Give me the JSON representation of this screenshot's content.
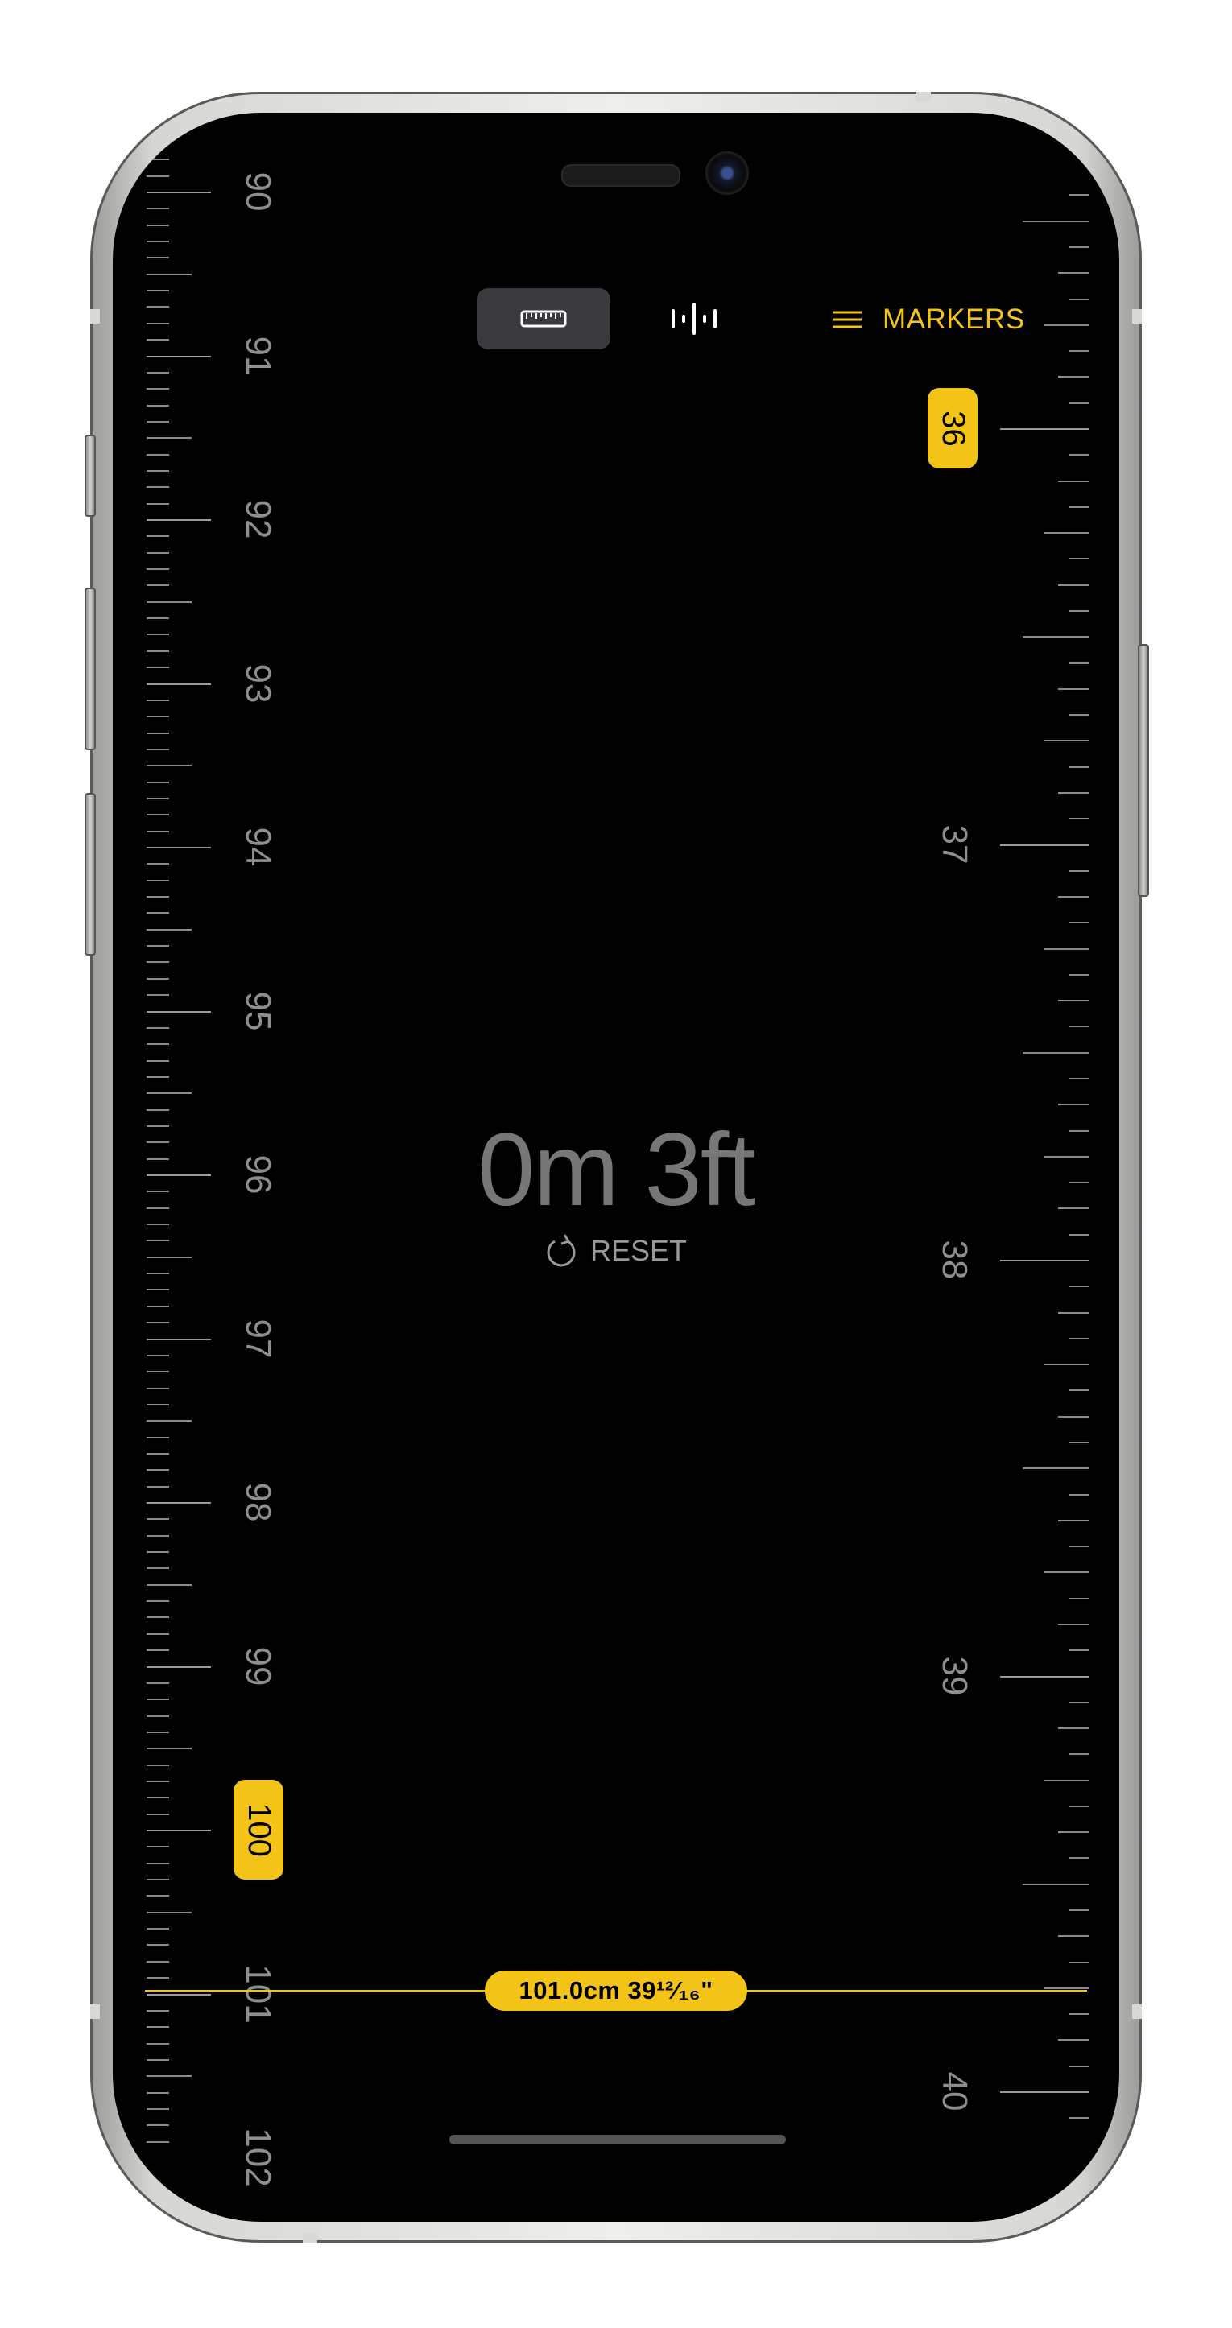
{
  "toolbar": {
    "modes": [
      {
        "name": "ruler-mode",
        "icon": "ruler-icon",
        "selected": true
      },
      {
        "name": "level-mode",
        "icon": "waveform-icon",
        "selected": false
      }
    ],
    "markers_label": "MARKERS"
  },
  "left_ruler": {
    "unit": "cm",
    "labels": [
      "90",
      "91",
      "92",
      "93",
      "94",
      "95",
      "96",
      "97",
      "98",
      "99",
      "100",
      "101",
      "102"
    ],
    "highlighted": "100"
  },
  "right_ruler": {
    "unit": "in",
    "labels": [
      "36",
      "37",
      "38",
      "39",
      "40"
    ],
    "highlighted": "36"
  },
  "readout": {
    "value": "0m  3ft",
    "reset_label": "RESET"
  },
  "measurement": {
    "label": "101.0cm  39¹²⁄₁₆\""
  },
  "colors": {
    "accent": "#f3c317",
    "background": "#000000",
    "tick": "#8a8a8a"
  }
}
